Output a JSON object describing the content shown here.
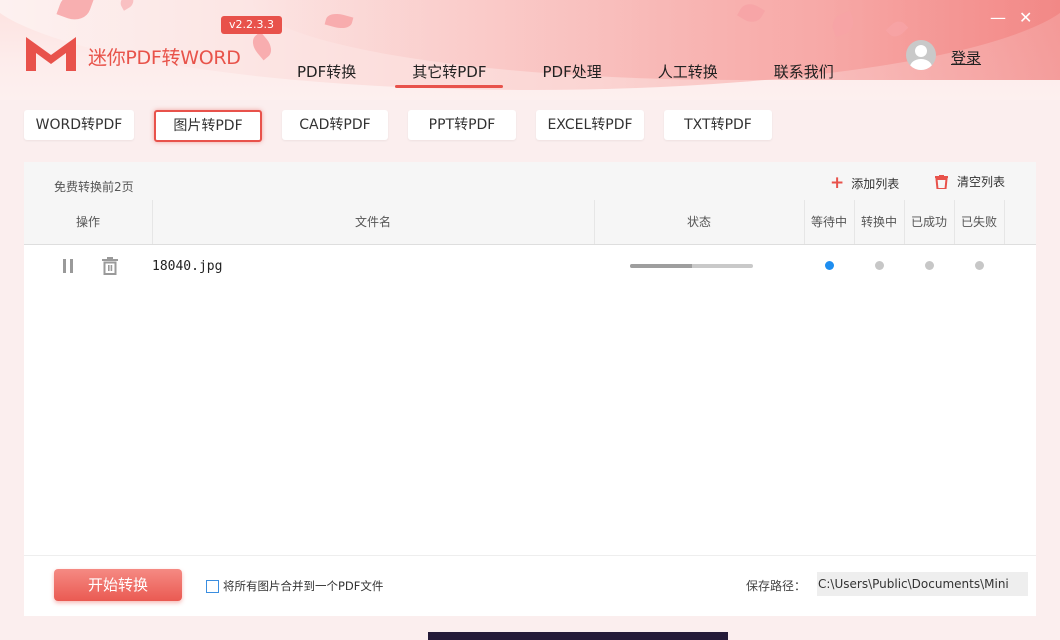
{
  "app": {
    "title": "迷你PDF转WORD",
    "version": "v2.2.3.3",
    "brand_color": "#e8524b"
  },
  "nav": {
    "items": [
      {
        "label": "PDF转换",
        "active": false
      },
      {
        "label": "其它转PDF",
        "active": true
      },
      {
        "label": "PDF处理",
        "active": false
      },
      {
        "label": "人工转换",
        "active": false
      },
      {
        "label": "联系我们",
        "active": false
      }
    ]
  },
  "user": {
    "login_label": "登录",
    "avatar_icon": "user-avatar-icon"
  },
  "window_controls": {
    "minimize": "—",
    "close": "✕"
  },
  "subtabs": {
    "items": [
      {
        "label": "WORD转PDF",
        "active": false
      },
      {
        "label": "图片转PDF",
        "active": true
      },
      {
        "label": "CAD转PDF",
        "active": false
      },
      {
        "label": "PPT转PDF",
        "active": false
      },
      {
        "label": "EXCEL转PDF",
        "active": false
      },
      {
        "label": "TXT转PDF",
        "active": false
      }
    ]
  },
  "list": {
    "free_note": "免费转换前2页",
    "add_label": "添加列表",
    "clear_label": "清空列表",
    "columns": {
      "actions": "操作",
      "filename": "文件名",
      "status": "状态",
      "waiting": "等待中",
      "converting": "转换中",
      "success": "已成功",
      "failed": "已失败"
    },
    "rows": [
      {
        "filename": "18040.jpg",
        "progress": 0.5,
        "state": "waiting"
      }
    ]
  },
  "bottom": {
    "start_label": "开始转换",
    "merge_label": "将所有图片合并到一个PDF文件",
    "merge_checked": false,
    "save_path_label": "保存路径：",
    "save_path_value": "C:\\Users\\Public\\Documents\\Mini"
  }
}
